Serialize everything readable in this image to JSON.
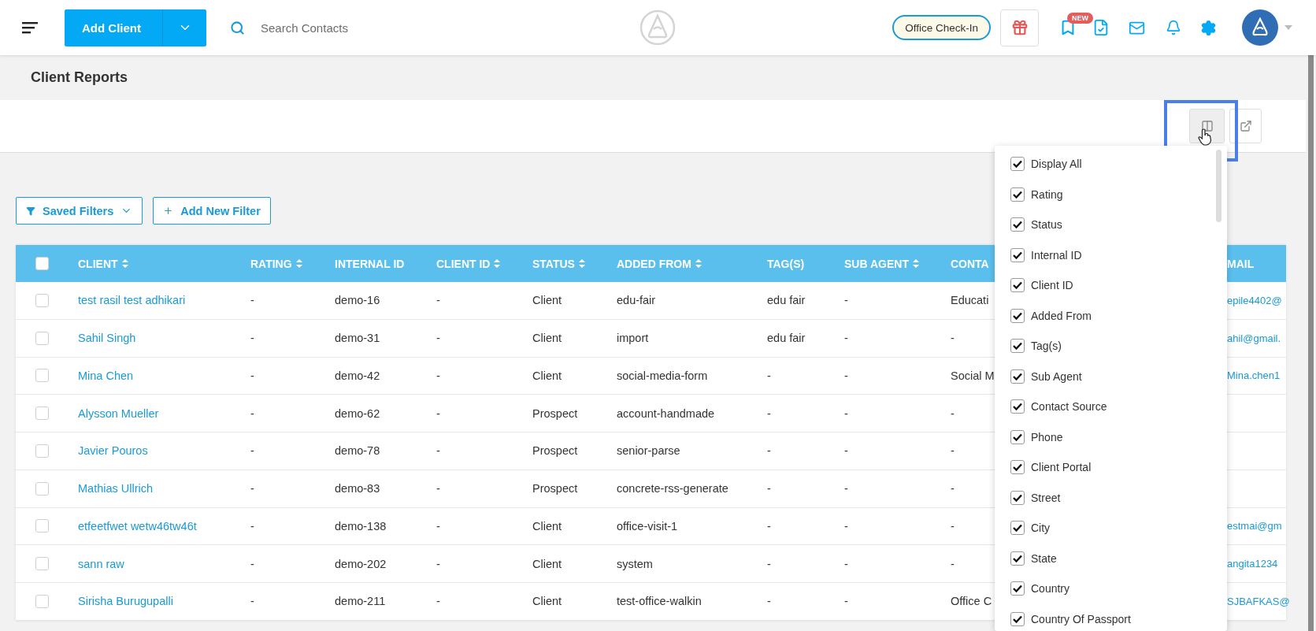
{
  "header": {
    "add_button": "Add Client",
    "search": {
      "placeholder": "Search Contacts"
    },
    "check_in": "Office Check-In",
    "new_badge": "NEW"
  },
  "page_title": "Client Reports",
  "filters": {
    "saved": "Saved Filters",
    "add": "Add New Filter"
  },
  "table": {
    "select_all": {
      "checked": false
    },
    "columns": [
      {
        "label": "CLIENT",
        "sortable": true,
        "kind": "link"
      },
      {
        "label": "RATING",
        "sortable": true,
        "kind": "text"
      },
      {
        "label": "INTERNAL ID",
        "sortable": false,
        "kind": "text"
      },
      {
        "label": "CLIENT ID",
        "sortable": true,
        "kind": "text"
      },
      {
        "label": "STATUS",
        "sortable": true,
        "kind": "text"
      },
      {
        "label": "ADDED FROM",
        "sortable": true,
        "kind": "text"
      },
      {
        "label": "TAG(S)",
        "sortable": false,
        "kind": "text"
      },
      {
        "label": "SUB AGENT",
        "sortable": true,
        "kind": "text"
      },
      {
        "label": "CONTA",
        "sortable": false,
        "kind": "text"
      },
      {
        "label": "MAIL",
        "sortable": false,
        "kind": "link"
      }
    ],
    "rows": [
      {
        "checked": false,
        "cells": [
          "test rasil test adhikari",
          "-",
          "demo-16",
          "-",
          "Client",
          "edu-fair",
          "edu fair",
          "-",
          "Educati",
          "epile4402@"
        ]
      },
      {
        "checked": false,
        "cells": [
          "Sahil Singh",
          "-",
          "demo-31",
          "-",
          "Client",
          "import",
          "edu fair",
          "-",
          "-",
          "ahil@gmail."
        ]
      },
      {
        "checked": false,
        "cells": [
          "Mina Chen",
          "-",
          "demo-42",
          "-",
          "Client",
          "social-media-form",
          "-",
          "-",
          "Social M",
          "Mina.chen1"
        ]
      },
      {
        "checked": false,
        "cells": [
          "Alysson Mueller",
          "-",
          "demo-62",
          "-",
          "Prospect",
          "account-handmade",
          "-",
          "-",
          "-"
        ]
      },
      {
        "checked": false,
        "cells": [
          "Javier Pouros",
          "-",
          "demo-78",
          "-",
          "Prospect",
          "senior-parse",
          "-",
          "-",
          "-"
        ]
      },
      {
        "checked": false,
        "cells": [
          "Mathias Ullrich",
          "-",
          "demo-83",
          "-",
          "Prospect",
          "concrete-rss-generate",
          "-",
          "-",
          "-"
        ]
      },
      {
        "checked": false,
        "cells": [
          "etfeetfwet wetw46tw46t",
          "-",
          "demo-138",
          "-",
          "Client",
          "office-visit-1",
          "-",
          "-",
          "-",
          "estmai@gm"
        ]
      },
      {
        "checked": false,
        "cells": [
          "sann raw",
          "-",
          "demo-202",
          "-",
          "Client",
          "system",
          "-",
          "-",
          "-",
          "angita1234"
        ]
      },
      {
        "checked": false,
        "cells": [
          "Sirisha Burugupalli",
          "-",
          "demo-211",
          "-",
          "Client",
          "test-office-walkin",
          "-",
          "-",
          "Office C",
          "SJBAFKAS@"
        ]
      }
    ]
  },
  "column_menu": {
    "items": [
      {
        "label": "Display All",
        "checked": true
      },
      {
        "label": "Rating",
        "checked": true
      },
      {
        "label": "Status",
        "checked": true
      },
      {
        "label": "Internal ID",
        "checked": true
      },
      {
        "label": "Client ID",
        "checked": true
      },
      {
        "label": "Added From",
        "checked": true
      },
      {
        "label": "Tag(s)",
        "checked": true
      },
      {
        "label": "Sub Agent",
        "checked": true
      },
      {
        "label": "Contact Source",
        "checked": true
      },
      {
        "label": "Phone",
        "checked": true
      },
      {
        "label": "Client Portal",
        "checked": true
      },
      {
        "label": "Street",
        "checked": true
      },
      {
        "label": "City",
        "checked": true
      },
      {
        "label": "State",
        "checked": true
      },
      {
        "label": "Country",
        "checked": true
      },
      {
        "label": "Country Of Passport",
        "checked": true
      }
    ]
  }
}
